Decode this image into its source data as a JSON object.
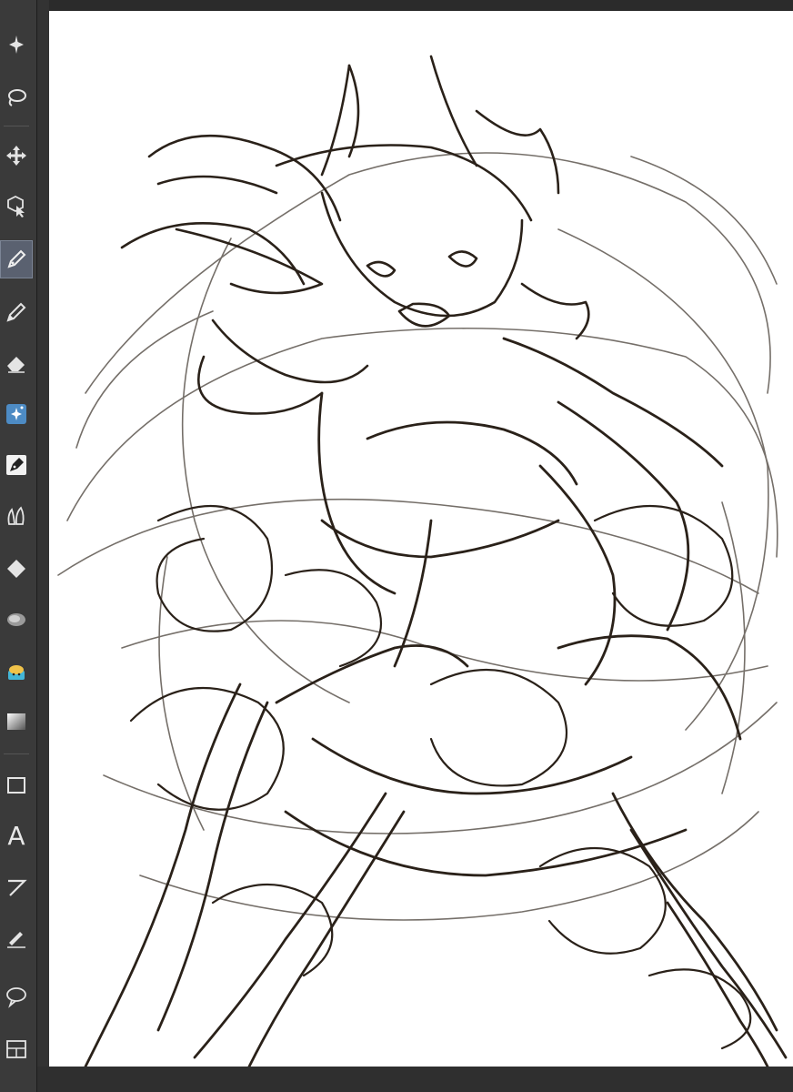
{
  "app": {
    "accent_color": "#5a6170",
    "canvas_color": "#ffffff",
    "stroke_color": "#2a2119"
  },
  "toolbar": {
    "tools": [
      {
        "icon": "magic-wand-icon",
        "active": false
      },
      {
        "icon": "lasso-icon",
        "active": false
      },
      {
        "icon": "move-icon",
        "active": false
      },
      {
        "icon": "object-select-icon",
        "active": false
      },
      {
        "icon": "pen-icon",
        "active": true
      },
      {
        "icon": "pencil-icon",
        "active": false
      },
      {
        "icon": "eraser-icon",
        "active": false
      },
      {
        "icon": "decoration-icon",
        "active": false
      },
      {
        "icon": "ink-pen-icon",
        "active": false
      },
      {
        "icon": "blend-icon",
        "active": false
      },
      {
        "icon": "fill-icon",
        "active": false
      },
      {
        "icon": "smudge-icon",
        "active": false
      },
      {
        "icon": "paint-bucket-icon",
        "active": false
      },
      {
        "icon": "gradient-icon",
        "active": false
      },
      {
        "icon": "rectangle-icon",
        "active": false
      },
      {
        "icon": "text-icon",
        "active": false,
        "glyph": "A"
      },
      {
        "icon": "line-icon",
        "active": false
      },
      {
        "icon": "ruler-pen-icon",
        "active": false
      },
      {
        "icon": "speech-balloon-icon",
        "active": false
      },
      {
        "icon": "frame-icon",
        "active": false
      }
    ]
  }
}
